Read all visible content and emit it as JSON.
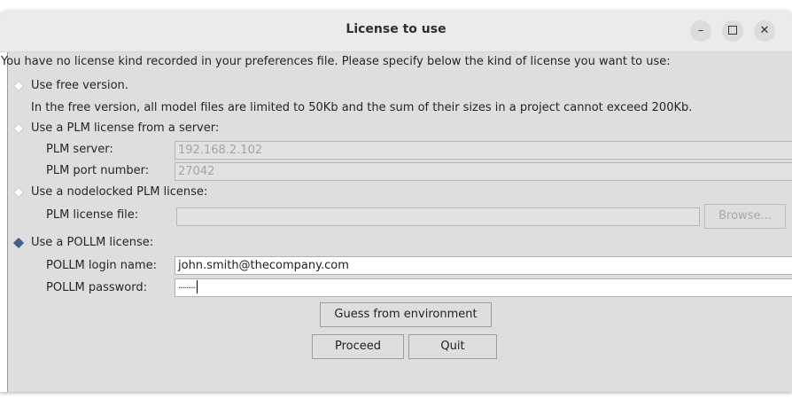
{
  "window": {
    "title": "License to use"
  },
  "intro_text": "You have no license kind recorded in your preferences file. Please specify below the kind of license you want to use:",
  "options": {
    "free": {
      "label": "Use free version.",
      "selected": false,
      "note": "In the free version, all model files are limited to 50Kb and the sum of their sizes in a project cannot exceed 200Kb."
    },
    "server": {
      "label": "Use a PLM license from a server:",
      "selected": false,
      "server_label": "PLM server:",
      "server_value": "192.168.2.102",
      "port_label": "PLM port number:",
      "port_value": "27042"
    },
    "nodelocked": {
      "label": "Use a nodelocked PLM license:",
      "selected": false,
      "file_label": "PLM license file:",
      "file_value": "",
      "browse_label": "Browse..."
    },
    "pollm": {
      "label": "Use a POLLM license:",
      "selected": true,
      "login_label": "POLLM login name:",
      "login_value": "john.smith@thecompany.com",
      "password_label": "POLLM password:",
      "password_value": "·········"
    }
  },
  "buttons": {
    "guess": "Guess from environment",
    "proceed": "Proceed",
    "quit": "Quit"
  },
  "icons": {
    "minimize": "minimize-icon",
    "maximize": "maximize-icon",
    "close": "close-icon"
  },
  "colors": {
    "radio_selected": "#46608a",
    "radio_unselected": "#ffffff"
  }
}
